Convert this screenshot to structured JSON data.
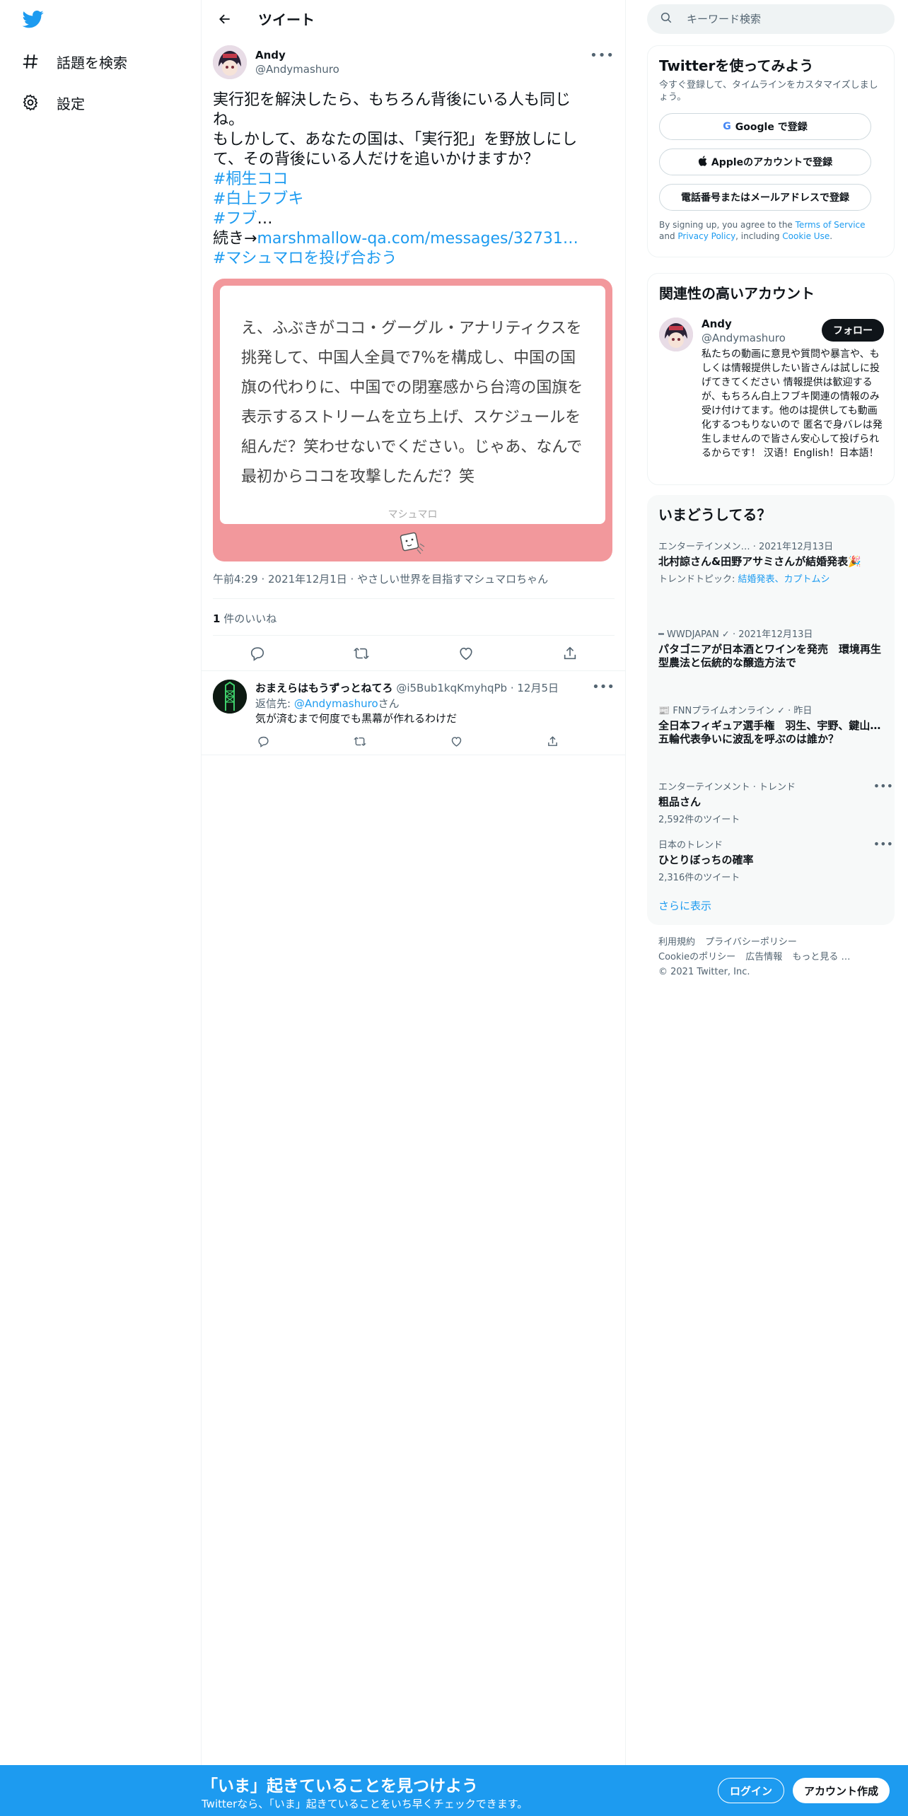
{
  "nav": {
    "items": [
      {
        "label": "話題を検索",
        "icon": "hash-icon"
      },
      {
        "label": "設定",
        "icon": "gear-icon"
      }
    ]
  },
  "header": {
    "title": "ツイート"
  },
  "tweet": {
    "author_name": "Andy",
    "author_handle": "@Andymashuro",
    "lines": [
      "実行犯を解決したら、もちろん背後にいる人も同じ",
      "ね。",
      "もしかして、あなたの国は、「実行犯」を野放しにし",
      "て、その背後にいる人だけを追いかけますか？"
    ],
    "hashtags": [
      "#桐生ココ",
      "#白上フブキ",
      "#フブ"
    ],
    "ellipsis": "…",
    "continue_prefix": "続き→",
    "link": "marshmallow-qa.com/messages/32731…",
    "last_hashtag": "#マシュマロを投げ合おう",
    "card": {
      "text": "え、ふぶきがココ・グーグル・アナリティクスを挑発して、中国人全員で7%を構成し、中国の国旗の代わりに、中国での閉塞感から台湾の国旗を表示するストリームを立ち上げ、スケジュールを組んだ？笑わせないでください。じゃあ、なんで最初からココを攻撃したんだ？笑",
      "brand": "マシュマロ",
      "color": "#f2989c"
    },
    "meta": "午前4:29 · 2021年12月1日 · やさしい世界を目指すマシュマロちゃん",
    "likes_count": "1",
    "likes_label": " 件のいいね"
  },
  "reply": {
    "name": "おまえらはもうずっとねてろ",
    "handle": "@i5Bub1kqKmyhqPb",
    "date": "· 12月5日",
    "reply_to_label": "返信先: ",
    "reply_to_handle": "@Andymashuro",
    "reply_to_suffix": "さん",
    "text": "気が済むまで何度でも黒幕が作れるわけだ"
  },
  "search": {
    "placeholder": "キーワード検索"
  },
  "signup": {
    "title": "Twitterを使ってみよう",
    "subtitle": "今すぐ登録して、タイムラインをカスタマイズしましょう。",
    "google": "Google で登録",
    "apple": "Appleのアカウントで登録",
    "phone": "電話番号またはメールアドレスで登録",
    "terms_prefix": "By signing up, you agree to the ",
    "terms_tos": "Terms of Service",
    "terms_and": " and ",
    "terms_privacy": "Privacy Policy",
    "terms_including": ", including ",
    "terms_cookie": "Cookie Use",
    "terms_end": "."
  },
  "related": {
    "title": "関連性の高いアカウント",
    "name": "Andy",
    "handle": "@Andymashuro",
    "follow": "フォロー",
    "bio": "私たちの動画に意見や質問や暴言や、もしくは情報提供したい皆さんは試しに投げてきてください 情報提供は歓迎するが、もちろん白上フブキ関連の情報のみ受け付けてます。他のは提供しても動画化するつもりないので 匿名で身バレは発生しませんので皆さん安心して投げられるからです！ 汉语！English！日本語！"
  },
  "trends": {
    "title": "いまどうしてる？",
    "items": [
      {
        "context": "エンターテインメン… · 2021年12月13日",
        "title": "北村諒さん&田野アサミさんが結婚発表🎉",
        "topic_prefix": "トレンドトピック: ",
        "topic": "結婚発表、カプトムシ"
      },
      {
        "context": "━ WWDJAPAN ✓ · 2021年12月13日",
        "title": "パタゴニアが日本酒とワインを発売　環境再生型農法と伝統的な醸造方法で"
      },
      {
        "context": "📰 FNNプライムオンライン ✓ · 昨日",
        "title": "全日本フィギュア選手権　羽生、宇野、鍵山…五輪代表争いに波乱を呼ぶのは誰か？"
      },
      {
        "context": "エンターテインメント · トレンド",
        "title": "粗品さん",
        "count": "2,592件のツイート"
      },
      {
        "context": "日本のトレンド",
        "title": "ひとりぼっちの確率",
        "count": "2,316件のツイート"
      }
    ],
    "show_more": "さらに表示"
  },
  "footer": {
    "links": [
      "利用規約",
      "プライバシーポリシー",
      "Cookieのポリシー",
      "広告情報",
      "もっと見る …"
    ],
    "copyright": "© 2021 Twitter, Inc."
  },
  "bottom_bar": {
    "title": "「いま」起きていることを見つけよう",
    "subtitle": "Twitterなら、「いま」起きていることをいち早くチェックできます。",
    "login": "ログイン",
    "signup": "アカウント作成"
  },
  "colors": {
    "accent": "#1d9bf0",
    "card": "#f2989c"
  }
}
